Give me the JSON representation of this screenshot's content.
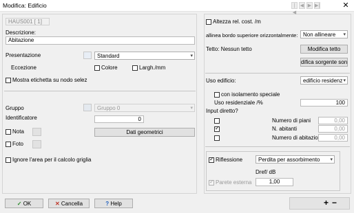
{
  "window": {
    "title": "Modifica: Edificio"
  },
  "left": {
    "id_value": "HAUS001  [  1]",
    "description_label": "Descrizione:",
    "description_value": "Abitazione",
    "presentation_label": "Presentazione",
    "presentation_value": "Standard",
    "exception_label": "Eccezione",
    "color_label": "Colore",
    "width_label": "Largh./mm",
    "show_label_node": "Mostra etichetta su nodo selez",
    "group_label": "Gruppo",
    "group_value": "Gruppo 0",
    "identifier_label": "Identificatore",
    "identifier_value": "0",
    "geo_button": "Dati geometrici",
    "note_label": "Nota",
    "photo_label": "Foto",
    "ignore_grid_label": "Ignore l'area per il calcolo griglia"
  },
  "right": {
    "height_rel_label": "Altezza rel. cost. /m",
    "align_label": "allinea bordo superiore orizzontalmente:",
    "align_value": "Non allineare",
    "roof_label": "Tetto: Nessun tetto",
    "modify_roof_button": "Modifica tetto",
    "modify_source_button": "difica sorgente sono",
    "building_use_label": "Uso edificio:",
    "building_use_value": "edificio residenz",
    "insulation_label": "con isolamento speciale",
    "residential_use_label": "Uso residenziale /%",
    "residential_use_value": "100",
    "direct_input_label": "Input diretto?",
    "floors_label": "Numero di piani",
    "floors_value": "0,00",
    "inhabitants_label": "N. abitanti",
    "inhabitants_value": "0,00",
    "dwellings_label": "Numero di abitazioni",
    "dwellings_value": "0,00",
    "reflection_label": "Riflessione",
    "reflection_value": "Perdita per assorbimento",
    "dref_label": "Dref/ dB",
    "outer_wall_label": "Parete esterna",
    "dref_value": "1,00"
  },
  "footer": {
    "ok": "OK",
    "cancel": "Cancella",
    "help": "Help",
    "nav": [
      "|◀",
      "◀",
      "▶",
      "▶|"
    ],
    "plus": "+",
    "minus": "−"
  },
  "colors": {
    "ok_green": "#2e8b2e",
    "cancel_red": "#c0392b",
    "help_blue": "#1f5fbf"
  }
}
